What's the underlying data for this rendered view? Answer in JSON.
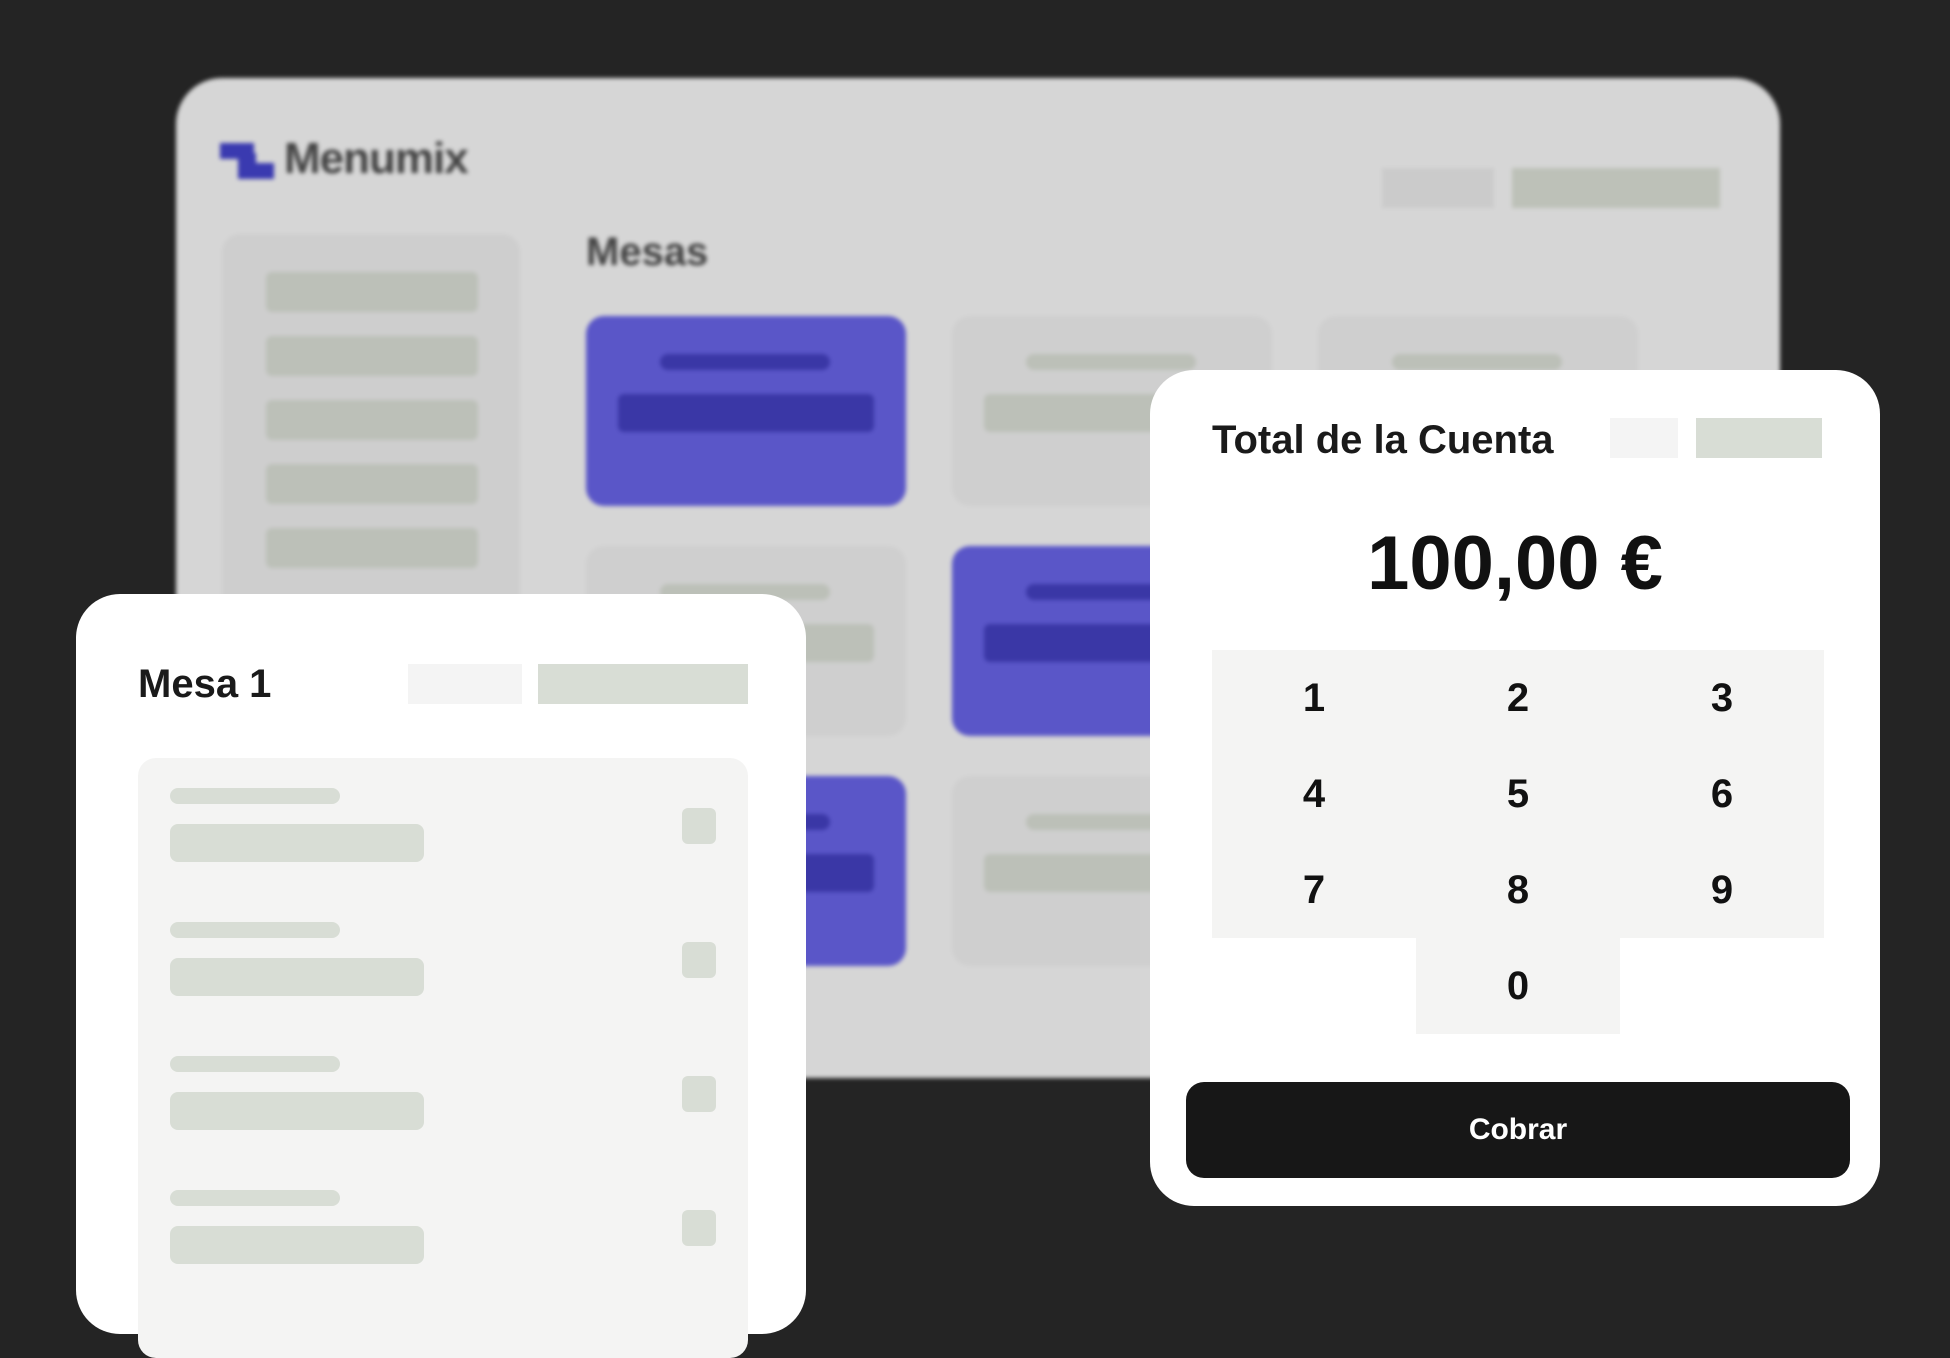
{
  "background_app": {
    "logo_text": "Menumix",
    "section_title": "Mesas"
  },
  "mesa_panel": {
    "title": "Mesa 1"
  },
  "total_panel": {
    "title": "Total de la Cuenta",
    "amount": "100,00 €",
    "keypad": [
      "1",
      "2",
      "3",
      "4",
      "5",
      "6",
      "7",
      "8",
      "9",
      "0"
    ],
    "charge_button": "Cobrar"
  },
  "colors": {
    "accent": "#5a56c8",
    "accent_dark": "#3a37a6",
    "button": "#171717",
    "background": "#242424"
  }
}
